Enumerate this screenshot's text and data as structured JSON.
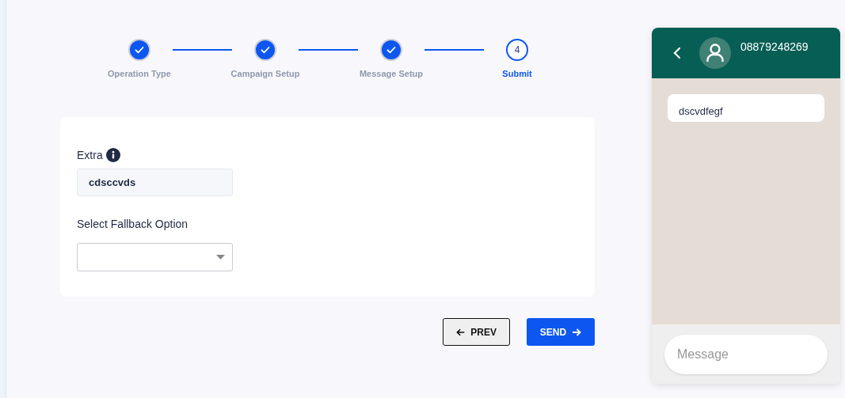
{
  "stepper": [
    {
      "label": "Operation Type",
      "completed": true,
      "selected": false
    },
    {
      "label": "Campaign Setup",
      "completed": true,
      "selected": false
    },
    {
      "label": "Message Setup",
      "completed": true,
      "selected": false
    },
    {
      "label": "Submit",
      "number": "4",
      "completed": false,
      "selected": true
    }
  ],
  "form": {
    "extra_label": "Extra",
    "extra_value": "cdsccvds",
    "fallback_label": "Select Fallback Option"
  },
  "buttons": {
    "prev": "PREV",
    "send": "SEND"
  },
  "preview": {
    "contact": "08879248269",
    "message": "dscvdfegf",
    "input_placeholder": "Message"
  }
}
